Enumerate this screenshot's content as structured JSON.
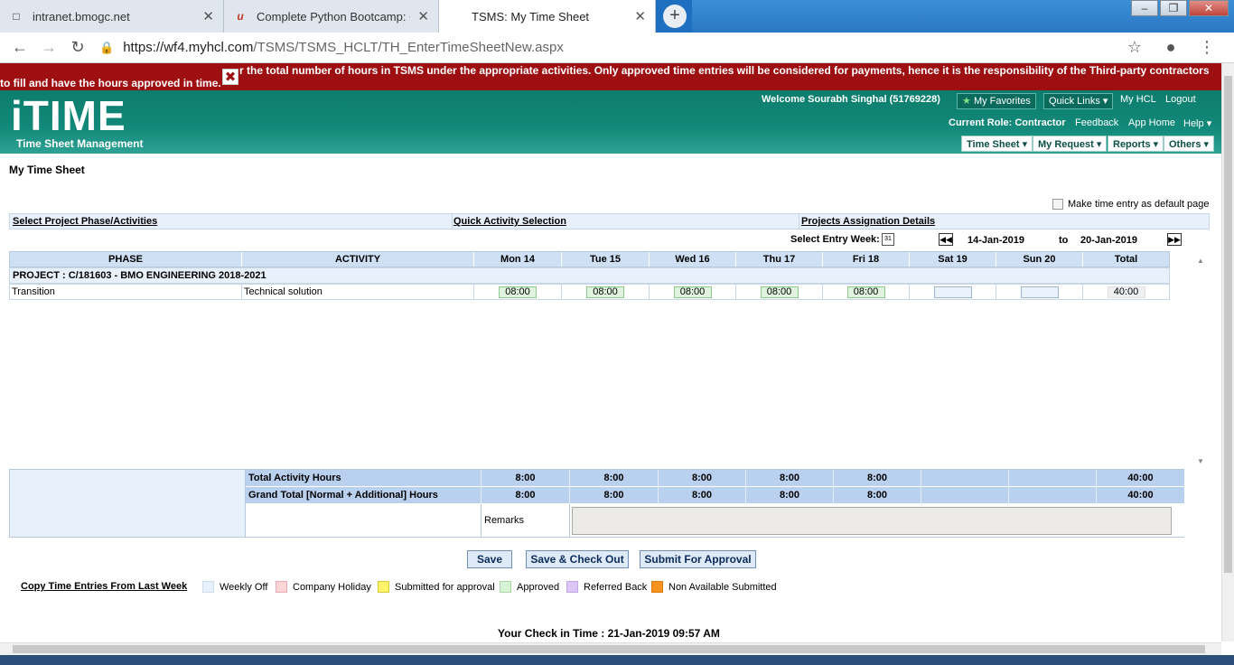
{
  "browser": {
    "tabs": [
      {
        "title": "intranet.bmogc.net",
        "icon": "page-icon"
      },
      {
        "title": "Complete Python Bootcamp: Go",
        "icon": "udemy-icon"
      },
      {
        "title": "TSMS: My Time Sheet",
        "icon": ""
      }
    ],
    "url_host": "https://wf4.myhcl.com",
    "url_path": "/TSMS/TSMS_HCLT/TH_EnterTimeSheetNew.aspx"
  },
  "banner": {
    "line1": "\"NOTE: Please fill in the total number of hours in TSMS under the appropriate activities. Only approved time entries will be considered for payments, hence it is the responsibility of the Third-party contractors",
    "line1_visible": "r the total number of hours in TSMS under the appropriate activities. Only approved time entries will be considered for payments, hence it is the responsibility of the Third-party contractors",
    "line2": "to fill and have the hours approved in time."
  },
  "header": {
    "logo": "iTIME",
    "logo_sub": "Time Sheet Management",
    "welcome": "Welcome Sourabh Singhal (51769228)",
    "my_favorites": "My Favorites",
    "quick_links": "Quick Links",
    "my_hcl": "My HCL",
    "logout": "Logout",
    "current_role": "Current Role: Contractor",
    "feedback": "Feedback",
    "app_home": "App Home",
    "help": "Help",
    "menus": [
      "Time Sheet",
      "My Request",
      "Reports",
      "Others"
    ]
  },
  "page": {
    "title": "My Time Sheet",
    "default_page_label": "Make time entry as default page",
    "links": [
      "Select Project Phase/Activities",
      "Quick Activity Selection",
      "Projects Assignation Details"
    ],
    "select_week_label": "Select Entry Week:",
    "week_from": "14-Jan-2019",
    "week_to_word": "to",
    "week_to": "20-Jan-2019"
  },
  "grid": {
    "headers": [
      "PHASE",
      "ACTIVITY",
      "Mon 14",
      "Tue 15",
      "Wed 16",
      "Thu 17",
      "Fri 18",
      "Sat 19",
      "Sun 20",
      "Total"
    ],
    "project": "PROJECT : C/181603 - BMO ENGINEERING 2018-2021",
    "row": {
      "phase": "Transition",
      "activity": "Technical solution",
      "hours": [
        "08:00",
        "08:00",
        "08:00",
        "08:00",
        "08:00",
        "",
        ""
      ],
      "total": "40:00"
    }
  },
  "totals": {
    "activity_label": "Total Activity Hours",
    "activity_values": [
      "8:00",
      "8:00",
      "8:00",
      "8:00",
      "8:00",
      "",
      "",
      "40:00"
    ],
    "grand_label": "Grand Total [Normal + Additional] Hours",
    "grand_values": [
      "8:00",
      "8:00",
      "8:00",
      "8:00",
      "8:00",
      "",
      "",
      "40:00"
    ],
    "remarks_label": "Remarks"
  },
  "buttons": {
    "save": "Save",
    "save_checkout": "Save & Check Out",
    "submit": "Submit For Approval"
  },
  "legend": {
    "copy_link": "Copy Time Entries From Last Week",
    "items": [
      {
        "label": "Weekly Off",
        "color": "#e6f1fb"
      },
      {
        "label": "Company Holiday",
        "color": "#fcd5d5"
      },
      {
        "label": "Submitted for approval",
        "color": "#fff46a"
      },
      {
        "label": "Approved",
        "color": "#d7f3d5"
      },
      {
        "label": "Referred Back",
        "color": "#dcc6f5"
      },
      {
        "label": "Non Available Submitted",
        "color": "#f7931e"
      }
    ]
  },
  "checkin": "Your Check in Time : 21-Jan-2019 09:57 AM"
}
